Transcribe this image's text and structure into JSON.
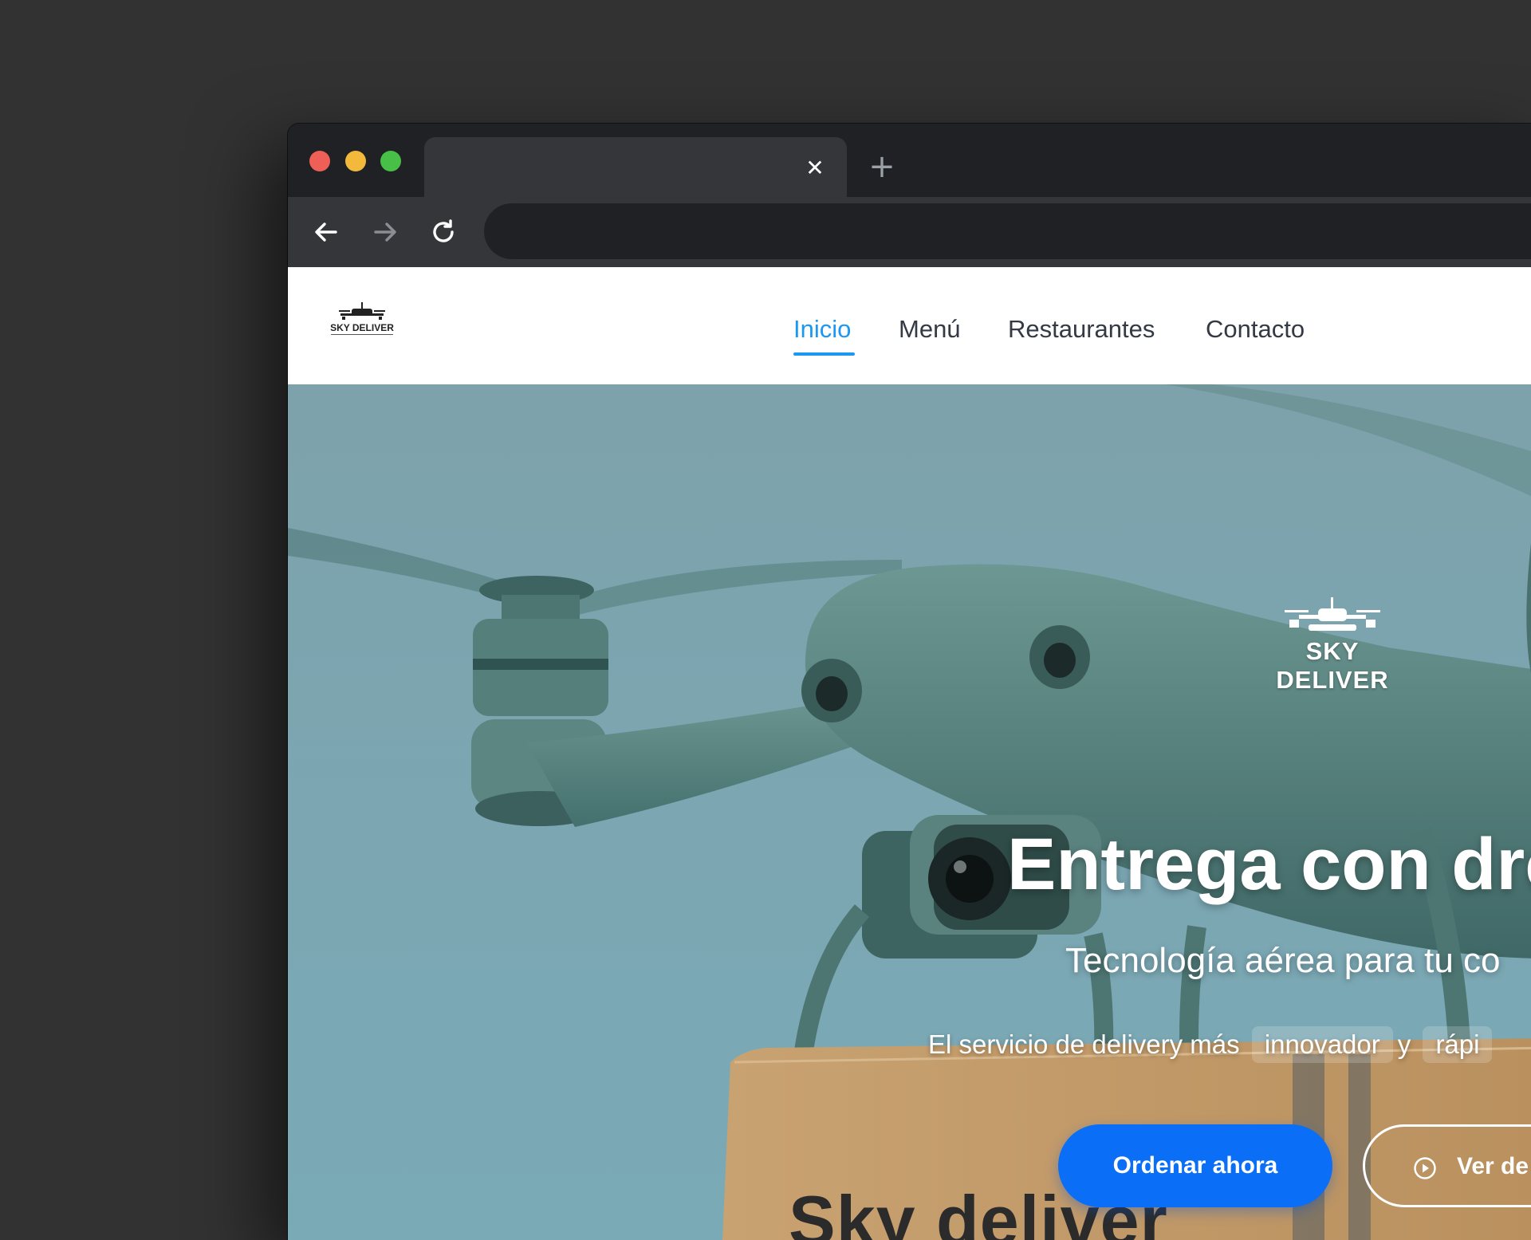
{
  "browser": {
    "tab_title": "",
    "tab_close_glyph": "✕",
    "new_tab_glyph": "+",
    "address": "",
    "icons": [
      "back-arrow-icon",
      "forward-arrow-icon",
      "reload-icon"
    ],
    "traffic_light_colors": {
      "close": "#ee5f57",
      "minimize": "#f3b93b",
      "zoom": "#48c047"
    }
  },
  "site": {
    "logo_text": "SKY DELIVER",
    "nav": {
      "items": [
        {
          "label": "Inicio",
          "active": true
        },
        {
          "label": "Menú",
          "active": false
        },
        {
          "label": "Restaurantes",
          "active": false
        },
        {
          "label": "Contacto",
          "active": false
        }
      ]
    },
    "hero": {
      "brand": "SKY DELIVER",
      "title": "Entrega con dro",
      "subtitle": "Tecnología aérea para tu co",
      "tagline_prefix": "El servicio de delivery más",
      "tagline_highlight_1": "innovador",
      "tagline_joiner": "y",
      "tagline_highlight_2": "rápi",
      "primary_button": "Ordenar ahora",
      "secondary_button": "Ver de",
      "box_print": "Sky deliver"
    },
    "colors": {
      "accent": "#1a98f4",
      "primary_button": "#0a6ef6",
      "hero_sky": "#7ba6b2",
      "drone_body": "#4f7a76"
    }
  }
}
